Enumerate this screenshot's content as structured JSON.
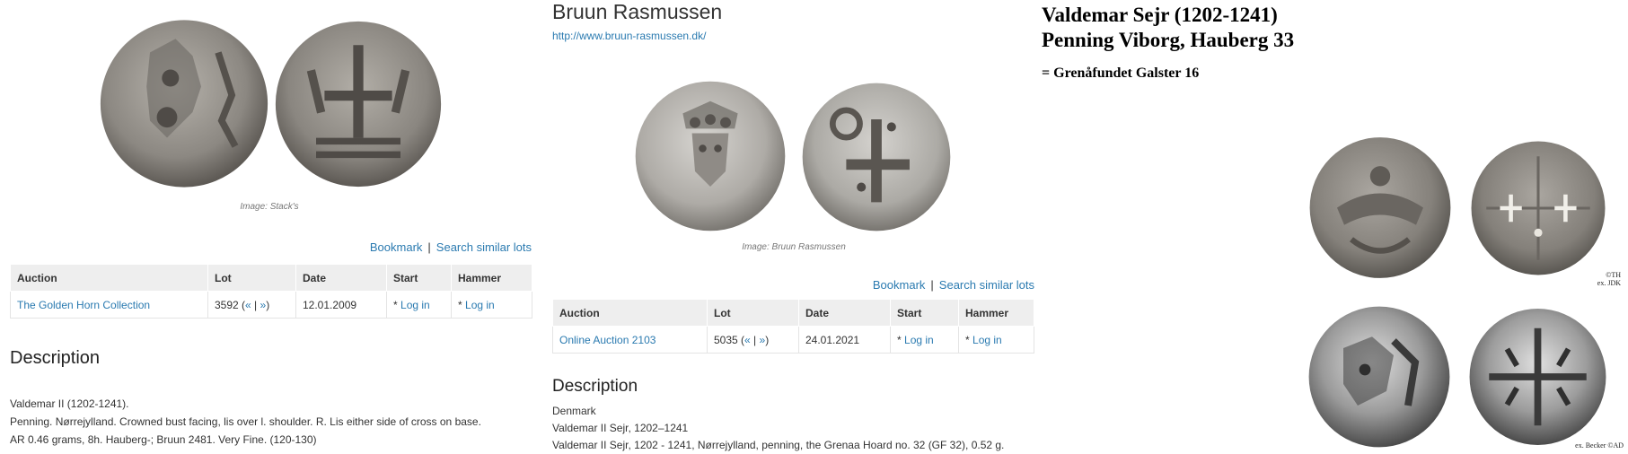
{
  "left": {
    "caption": "Image: Stack's",
    "actions": {
      "bookmark": "Bookmark",
      "separator": "|",
      "search": "Search similar lots"
    },
    "table": {
      "headers": [
        "Auction",
        "Lot",
        "Date",
        "Start",
        "Hammer"
      ],
      "row": {
        "auction": "The Golden Horn Collection",
        "lot_prefix": "3592 (",
        "prev": "«",
        "lot_sep": " | ",
        "next": "»",
        "lot_suffix": ")",
        "date": "12.01.2009",
        "start_star": "* ",
        "start_link": "Log in",
        "hammer_star": "* ",
        "hammer_link": "Log in"
      }
    },
    "description": {
      "heading": "Description",
      "lines": [
        "Valdemar II (1202-1241).",
        "Penning. Nørrejylland. Crowned bust facing, lis over l. shoulder. R. Lis either side of cross on base.",
        "AR 0.46 grams, 8h. Hauberg-; Bruun 2481. Very Fine. (120-130)"
      ]
    }
  },
  "middle": {
    "title": "Bruun Rasmussen",
    "url": "http://www.bruun-rasmussen.dk/",
    "caption": "Image: Bruun Rasmussen",
    "actions": {
      "bookmark": "Bookmark",
      "separator": "|",
      "search": "Search similar lots"
    },
    "table": {
      "headers": [
        "Auction",
        "Lot",
        "Date",
        "Start",
        "Hammer"
      ],
      "row": {
        "auction": "Online Auction 2103",
        "lot_prefix": "5035 (",
        "prev": "«",
        "lot_sep": " | ",
        "next": "»",
        "lot_suffix": ")",
        "date": "24.01.2021",
        "start_star": "* ",
        "start_link": "Log in",
        "hammer_star": "* ",
        "hammer_link": "Log in"
      }
    },
    "description": {
      "heading": "Description",
      "lines": [
        "Denmark",
        "Valdemar II Sejr, 1202–1241",
        "Valdemar II Sejr, 1202 - 1241, Nørrejylland, penning, the Grenaa Hoard no. 32 (GF 32), 0.52 g."
      ]
    }
  },
  "right": {
    "title_line1": "Valdemar Sejr (1202-1241)",
    "title_line2": "Penning Viborg, Hauberg 33",
    "subtitle": "= Grenåfundet Galster 16",
    "credit_top_1": "©TH",
    "credit_top_2": "ex. JDK",
    "credit_bottom": "ex. Becker ©AD"
  },
  "colors": {
    "link": "#2a7ab0",
    "table_header_bg": "#eeeeee"
  }
}
